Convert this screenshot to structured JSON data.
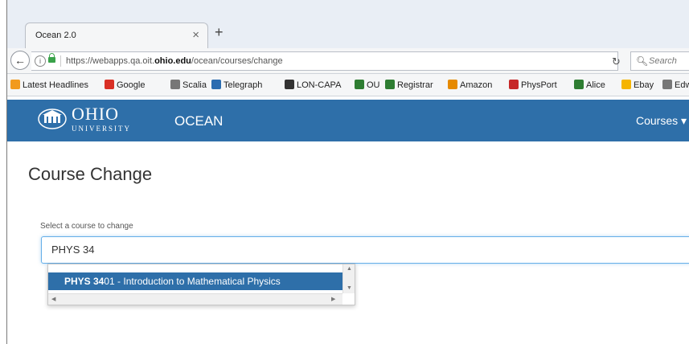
{
  "browser": {
    "tab_title": "Ocean 2.0",
    "tab_close": "×",
    "new_tab": "+",
    "url_prefix": "https://webapps.qa.oit.",
    "url_domain": "ohio.edu",
    "url_suffix": "/ocean/courses/change",
    "search_placeholder": "Search"
  },
  "bookmarks": [
    {
      "label": "Latest Headlines",
      "icon": "rss-icon",
      "color": "#f29a1d"
    },
    {
      "label": "Google",
      "icon": "gmail-icon",
      "color": "#d93025"
    },
    {
      "label": "Scalia",
      "icon": "globe-icon",
      "color": "#777777"
    },
    {
      "label": "Telegraph",
      "icon": "telegraph-icon",
      "color": "#2b6cb0"
    },
    {
      "label": "LON-CAPA",
      "icon": "loncapa-icon",
      "color": "#333333"
    },
    {
      "label": "OU",
      "icon": "ohio-seal-icon",
      "color": "#2e7d32"
    },
    {
      "label": "Registrar",
      "icon": "ohio-seal-icon",
      "color": "#2e7d32"
    },
    {
      "label": "Amazon",
      "icon": "amazon-icon",
      "color": "#e68a00"
    },
    {
      "label": "PhysPort",
      "icon": "physport-icon",
      "color": "#c62828"
    },
    {
      "label": "Alice",
      "icon": "alice-icon",
      "color": "#2e7d32"
    },
    {
      "label": "Ebay",
      "icon": "ebay-icon",
      "color": "#f5b400"
    },
    {
      "label": "Edwa",
      "icon": "globe-icon",
      "color": "#777777"
    }
  ],
  "site": {
    "logo_word": "OHIO",
    "logo_sub": "UNIVERSITY",
    "brand": "OCEAN",
    "courses_menu": "Courses ▾"
  },
  "page": {
    "title": "Course Change",
    "field_label": "Select a course to change",
    "input_value": "PHYS 34",
    "suggestion_match": "PHYS 34",
    "suggestion_rest": "01 - Introduction to Mathematical Physics"
  },
  "colors": {
    "header_blue": "#2e6fa9",
    "focus_blue": "#66afe9"
  }
}
